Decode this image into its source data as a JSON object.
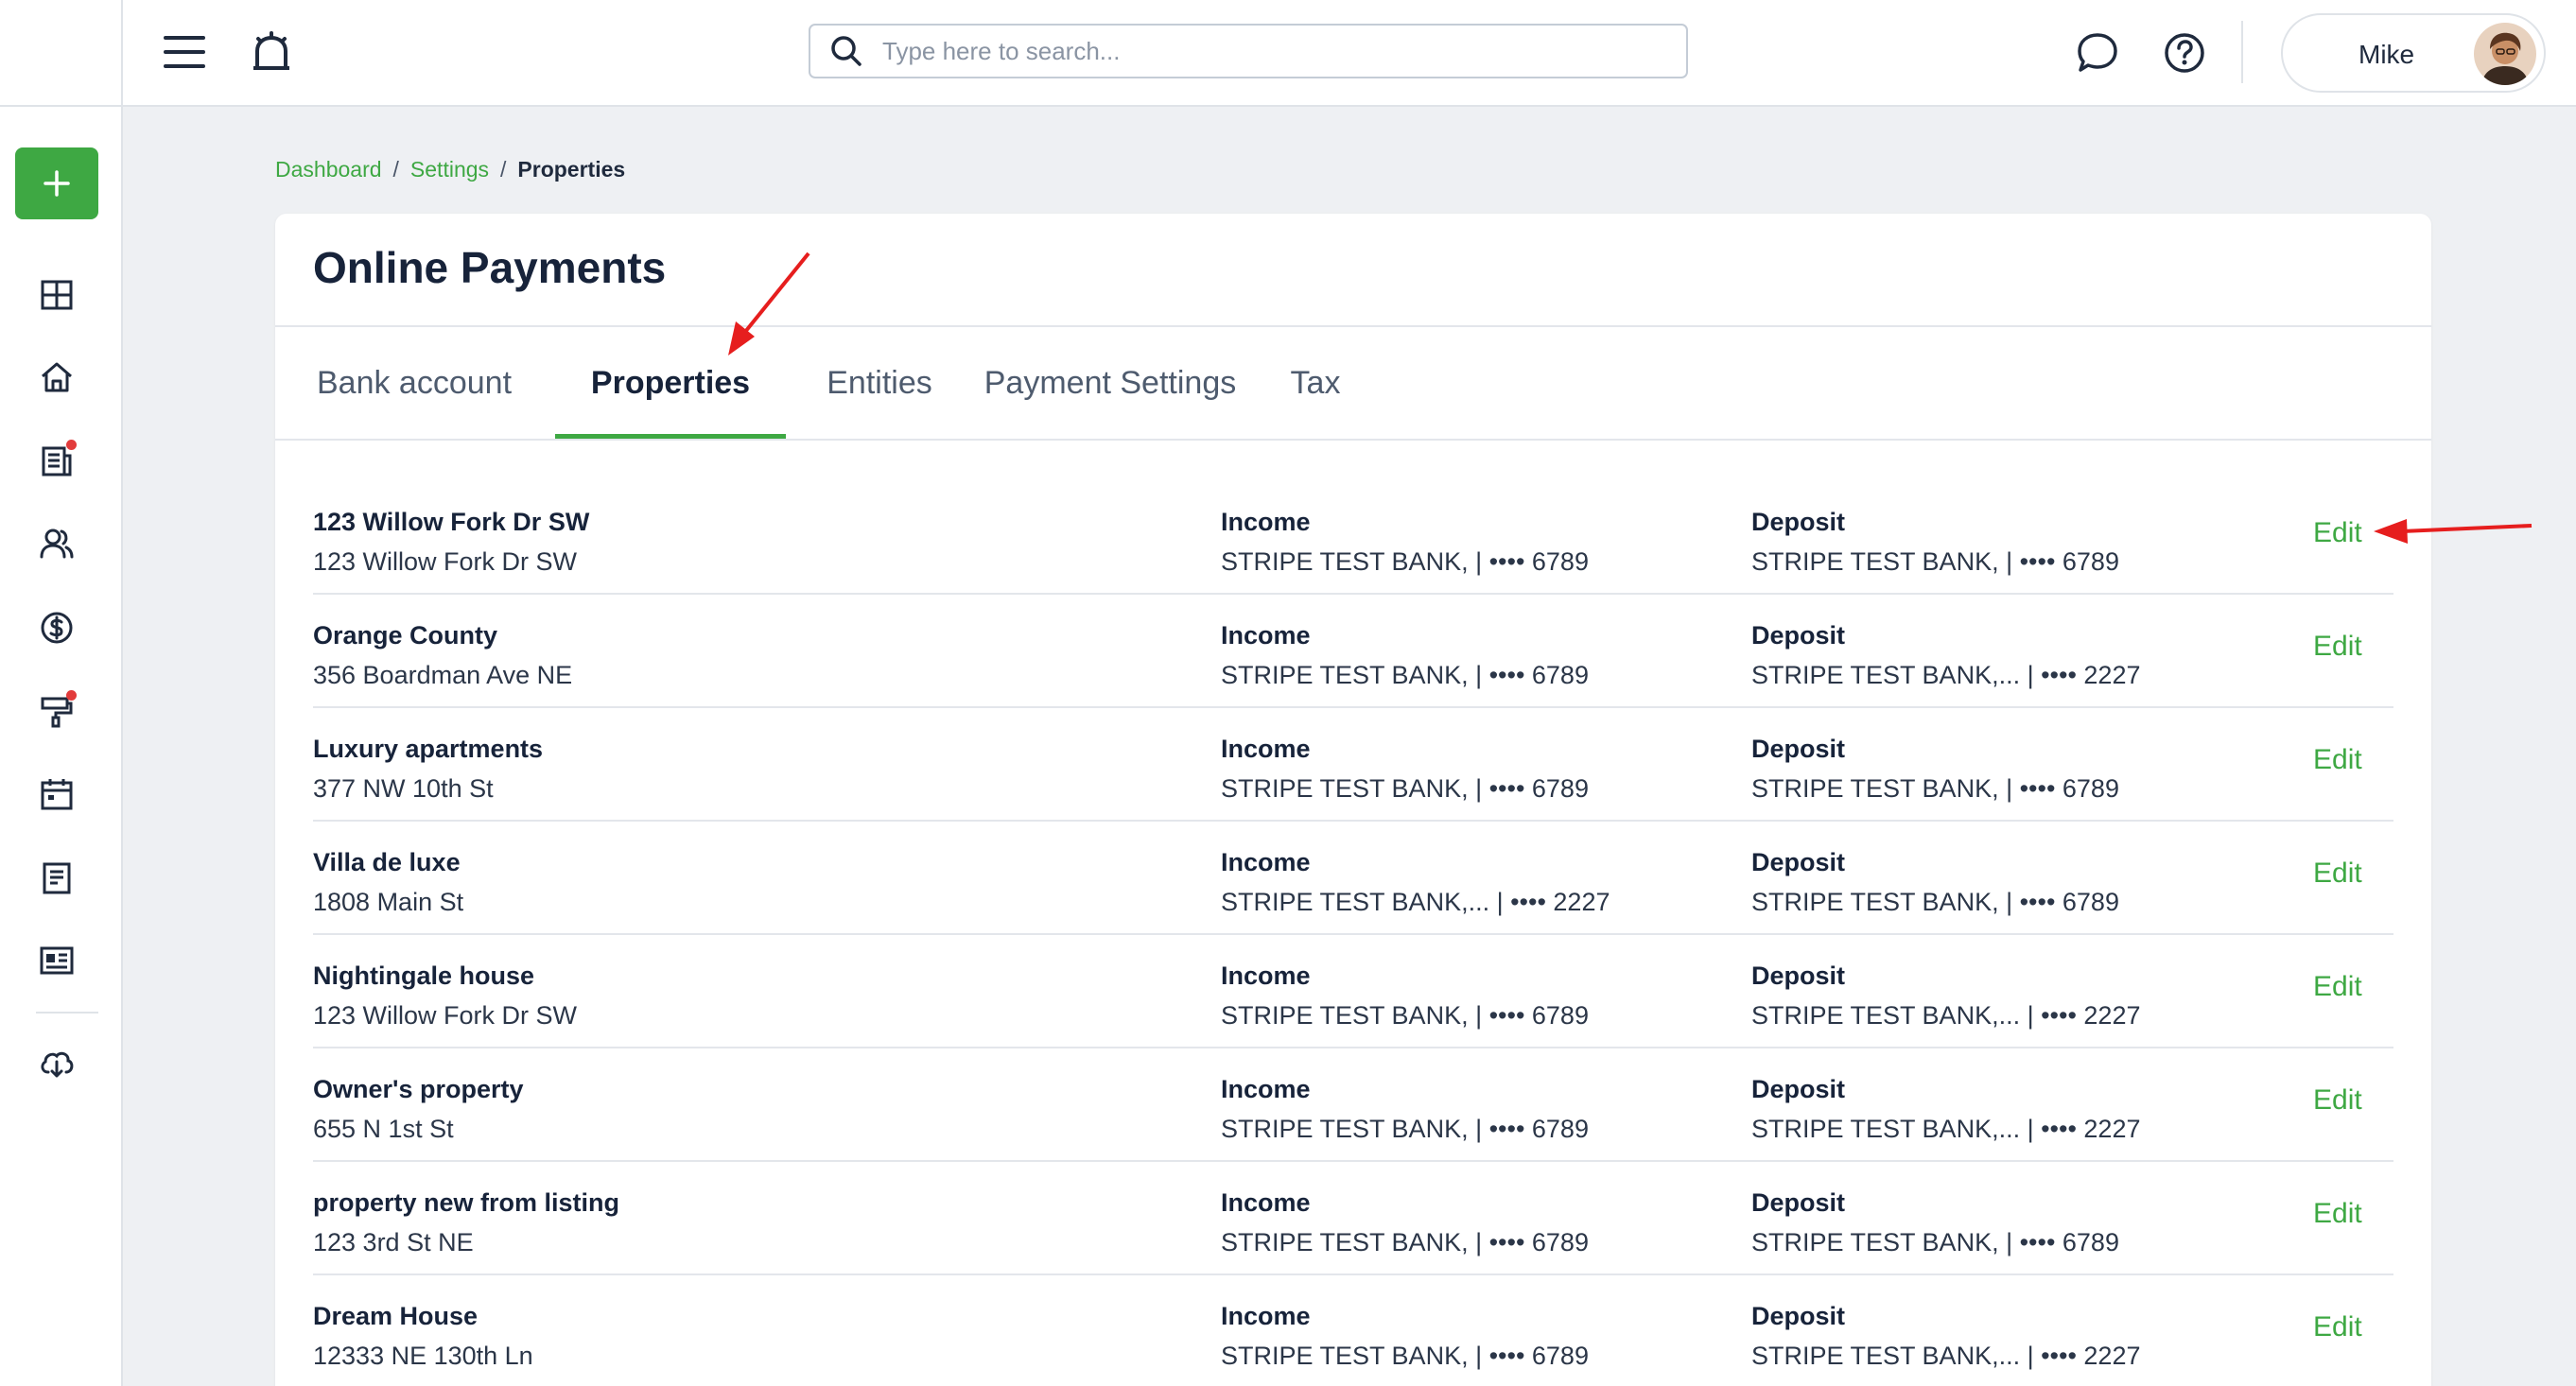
{
  "topbar": {
    "search_placeholder": "Type here to search...",
    "user_name": "Mike"
  },
  "breadcrumb": {
    "items": [
      "Dashboard",
      "Settings"
    ],
    "current": "Properties",
    "separator": "/"
  },
  "page": {
    "title": "Online Payments"
  },
  "tabs": [
    {
      "label": "Bank account"
    },
    {
      "label": "Properties"
    },
    {
      "label": "Entities"
    },
    {
      "label": "Payment Settings"
    },
    {
      "label": "Tax"
    }
  ],
  "active_tab": "Properties",
  "properties": [
    {
      "name": "123 Willow Fork Dr SW",
      "address": "123 Willow Fork Dr SW",
      "income_label": "Income",
      "income": "STRIPE TEST BANK, | •••• 6789",
      "deposit_label": "Deposit",
      "deposit": "STRIPE TEST BANK, | •••• 6789",
      "edit": "Edit"
    },
    {
      "name": "Orange County",
      "address": "356 Boardman Ave NE",
      "income_label": "Income",
      "income": "STRIPE TEST BANK, | •••• 6789",
      "deposit_label": "Deposit",
      "deposit": "STRIPE TEST BANK,... | •••• 2227",
      "edit": "Edit"
    },
    {
      "name": "Luxury apartments",
      "address": "377 NW 10th St",
      "income_label": "Income",
      "income": "STRIPE TEST BANK, | •••• 6789",
      "deposit_label": "Deposit",
      "deposit": "STRIPE TEST BANK, | •••• 6789",
      "edit": "Edit"
    },
    {
      "name": "Villa de luxe",
      "address": "1808 Main St",
      "income_label": "Income",
      "income": "STRIPE TEST BANK,... | •••• 2227",
      "deposit_label": "Deposit",
      "deposit": "STRIPE TEST BANK, | •••• 6789",
      "edit": "Edit"
    },
    {
      "name": "Nightingale house",
      "address": "123 Willow Fork Dr SW",
      "income_label": "Income",
      "income": "STRIPE TEST BANK, | •••• 6789",
      "deposit_label": "Deposit",
      "deposit": "STRIPE TEST BANK,... | •••• 2227",
      "edit": "Edit"
    },
    {
      "name": "Owner's property",
      "address": "655 N 1st St",
      "income_label": "Income",
      "income": "STRIPE TEST BANK, | •••• 6789",
      "deposit_label": "Deposit",
      "deposit": "STRIPE TEST BANK,... | •••• 2227",
      "edit": "Edit"
    },
    {
      "name": "property new from listing",
      "address": "123 3rd St NE",
      "income_label": "Income",
      "income": "STRIPE TEST BANK, | •••• 6789",
      "deposit_label": "Deposit",
      "deposit": "STRIPE TEST BANK, | •••• 6789",
      "edit": "Edit"
    },
    {
      "name": "Dream House",
      "address": "12333 NE 130th Ln",
      "income_label": "Income",
      "income": "STRIPE TEST BANK, | •••• 6789",
      "deposit_label": "Deposit",
      "deposit": "STRIPE TEST BANK,... | •••• 2227",
      "edit": "Edit"
    }
  ],
  "sidebar": {
    "icons": [
      "plus-icon",
      "dashboard-icon",
      "home-icon",
      "news-icon",
      "people-icon",
      "dollar-icon",
      "paint-roller-icon",
      "calendar-icon",
      "document-icon",
      "listing-icon",
      "download-icon"
    ]
  },
  "colors": {
    "accent": "#3ea843",
    "annotation": "#e61e1e",
    "notification_dot": "#e23b3b"
  }
}
